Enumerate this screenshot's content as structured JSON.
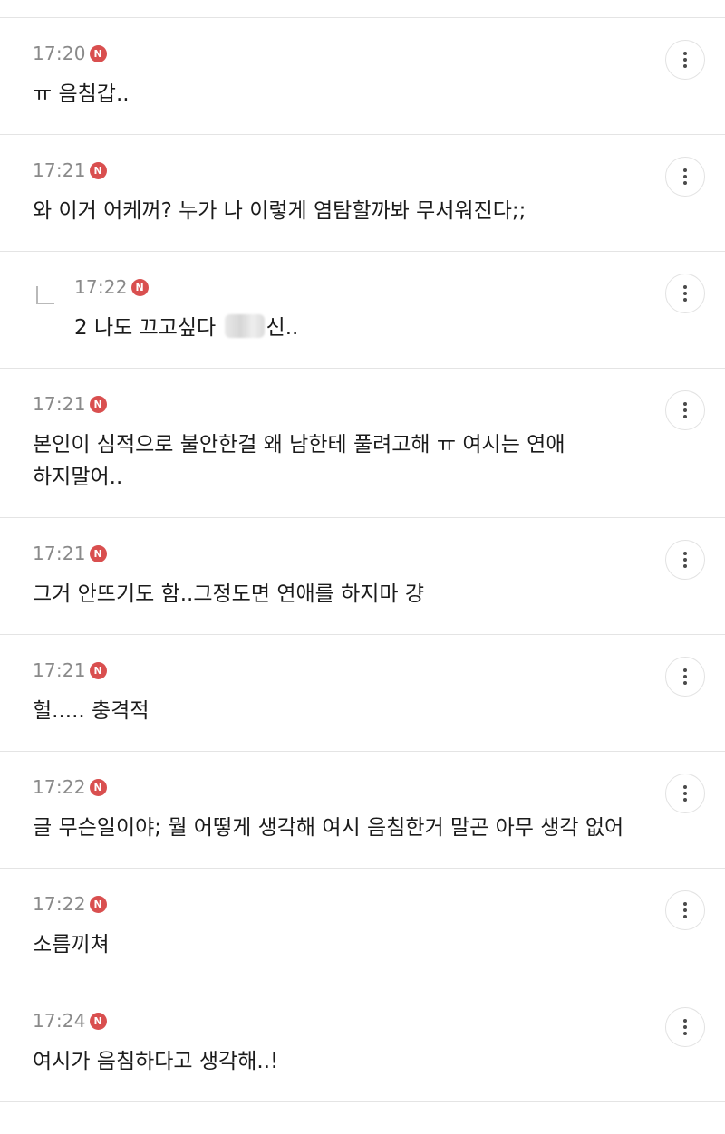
{
  "comments": [
    {
      "time": "17:20",
      "badge": "N",
      "text": "ㅠ 음침갑..",
      "reply": false
    },
    {
      "time": "17:21",
      "badge": "N",
      "text": "와 이거 어케꺼? 누가 나 이렇게 염탐할까봐 무서워진다;;",
      "reply": false
    },
    {
      "time": "17:22",
      "badge": "N",
      "text_before": "2 나도 끄고싶다 ",
      "text_after": "신..",
      "reply": true
    },
    {
      "time": "17:21",
      "badge": "N",
      "text": "본인이 심적으로 불안한걸 왜 남한테 풀려고해 ㅠ 여시는 연애 하지말어..",
      "reply": false
    },
    {
      "time": "17:21",
      "badge": "N",
      "text": "그거 안뜨기도 함..그정도면 연애를 하지마 걍",
      "reply": false
    },
    {
      "time": "17:21",
      "badge": "N",
      "text": "헐..... 충격적",
      "reply": false
    },
    {
      "time": "17:22",
      "badge": "N",
      "text": "글 무슨일이야; 뭘 어떻게 생각해 여시 음침한거 말곤 아무 생각 없어",
      "reply": false
    },
    {
      "time": "17:22",
      "badge": "N",
      "text": "소름끼쳐",
      "reply": false
    },
    {
      "time": "17:24",
      "badge": "N",
      "text": "여시가 음침하다고 생각해..!",
      "reply": false
    }
  ],
  "icons": {
    "new_badge": "new-badge-icon",
    "more": "more-options-icon",
    "reply": "reply-arrow-icon"
  },
  "colors": {
    "badge": "#d94f4f",
    "time": "#8a8a8a",
    "divider": "#e4e4e4"
  }
}
